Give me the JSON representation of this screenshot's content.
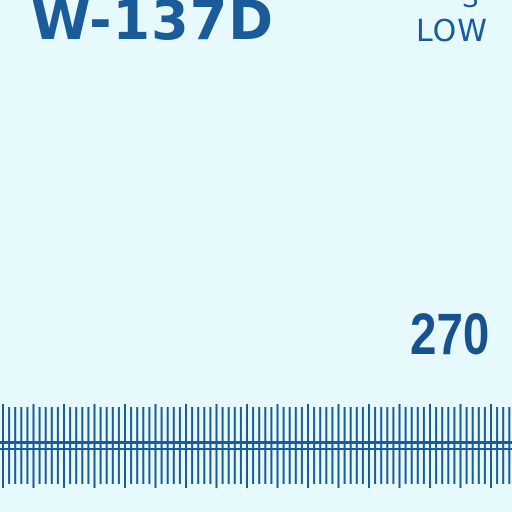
{
  "chart_id": "W-137D",
  "top_right_partial": "S",
  "low_label": "LOW",
  "heading_value": "270",
  "colors": {
    "background": "#e6f9fc",
    "ink": "#1a5b9a"
  }
}
